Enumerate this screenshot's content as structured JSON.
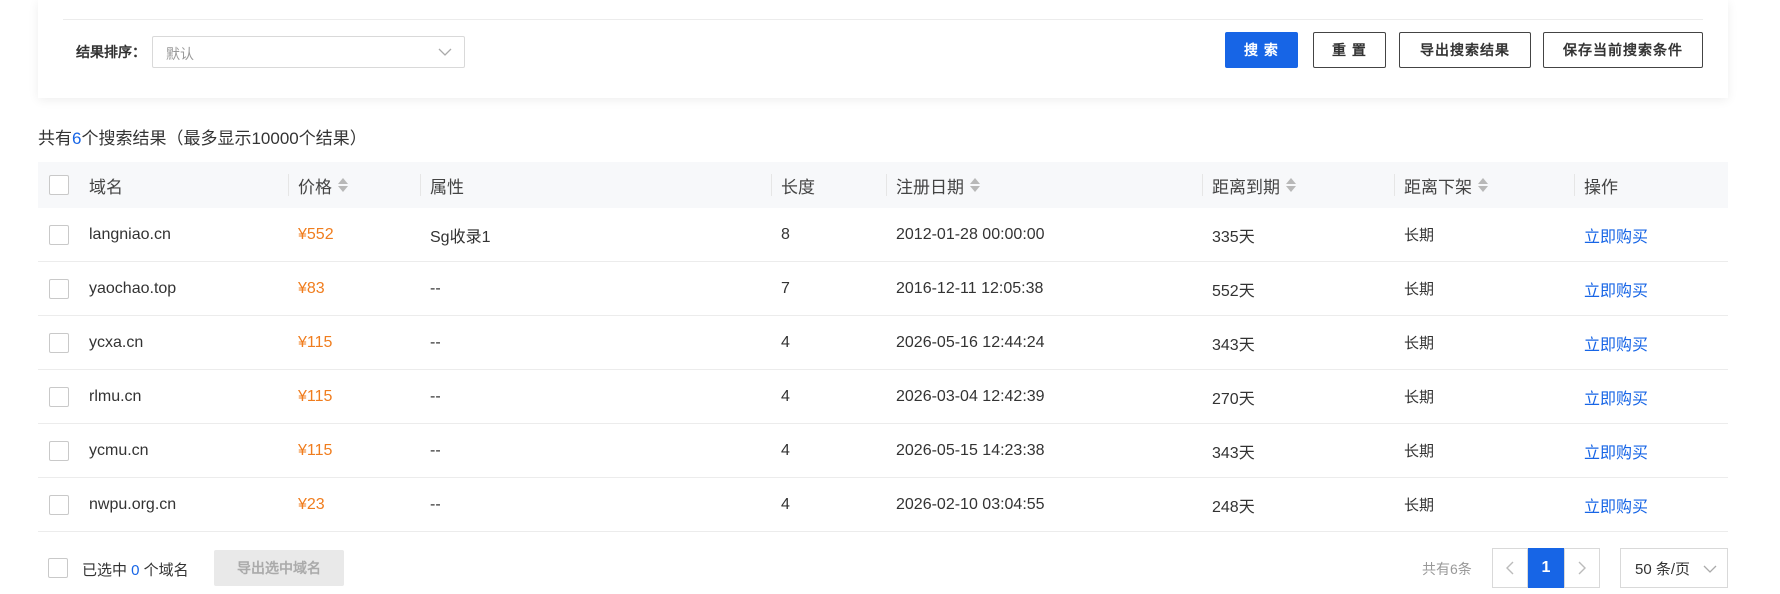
{
  "filters": {
    "sort_label": "结果排序：",
    "sort_value": "默认"
  },
  "buttons": {
    "search": "搜 索",
    "reset": "重 置",
    "export_results": "导出搜索结果",
    "save_conditions": "保存当前搜索条件"
  },
  "summary": {
    "prefix": "共有",
    "count": "6",
    "suffix": "个搜索结果（最多显示10000个结果）"
  },
  "table": {
    "headers": {
      "domain": "域名",
      "price": "价格",
      "attr": "属性",
      "length": "长度",
      "reg_date": "注册日期",
      "expire": "距离到期",
      "offshelf": "距离下架",
      "action": "操作"
    },
    "rows": [
      {
        "domain": "langniao.cn",
        "price": "¥552",
        "attr": "Sg收录1",
        "length": "8",
        "reg_date": "2012-01-28 00:00:00",
        "expire": "335天",
        "offshelf": "长期",
        "action": "立即购买"
      },
      {
        "domain": "yaochao.top",
        "price": "¥83",
        "attr": "--",
        "length": "7",
        "reg_date": "2016-12-11 12:05:38",
        "expire": "552天",
        "offshelf": "长期",
        "action": "立即购买"
      },
      {
        "domain": "ycxa.cn",
        "price": "¥115",
        "attr": "--",
        "length": "4",
        "reg_date": "2026-05-16 12:44:24",
        "expire": "343天",
        "offshelf": "长期",
        "action": "立即购买"
      },
      {
        "domain": "rlmu.cn",
        "price": "¥115",
        "attr": "--",
        "length": "4",
        "reg_date": "2026-03-04 12:42:39",
        "expire": "270天",
        "offshelf": "长期",
        "action": "立即购买"
      },
      {
        "domain": "ycmu.cn",
        "price": "¥115",
        "attr": "--",
        "length": "4",
        "reg_date": "2026-05-15 14:23:38",
        "expire": "343天",
        "offshelf": "长期",
        "action": "立即购买"
      },
      {
        "domain": "nwpu.org.cn",
        "price": "¥23",
        "attr": "--",
        "length": "4",
        "reg_date": "2026-02-10 03:04:55",
        "expire": "248天",
        "offshelf": "长期",
        "action": "立即购买"
      }
    ]
  },
  "footer": {
    "selected_prefix": "已选中 ",
    "selected_count": "0",
    "selected_suffix": " 个域名",
    "export_selected": "导出选中域名",
    "total": "共有6条",
    "current_page": "1",
    "page_size": "50 条/页"
  },
  "colors": {
    "accent": "#1765e6",
    "price": "#f07d1e"
  }
}
